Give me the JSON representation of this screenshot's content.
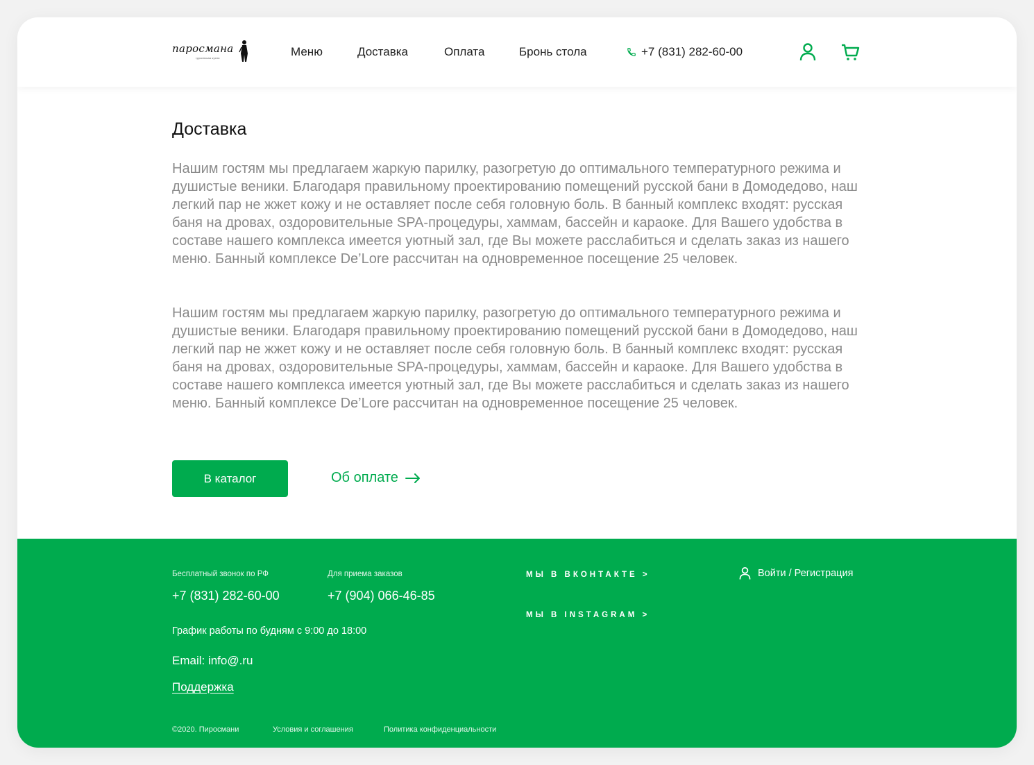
{
  "header": {
    "logo": {
      "name": "паросмана",
      "sub": "грузинская кухня"
    },
    "nav": [
      "Меню",
      "Доставка",
      "Оплата",
      "Бронь стола"
    ],
    "phone": "+7 (831) 282-60-00"
  },
  "main": {
    "title": "Доставка",
    "paragraphs": [
      "Нашим гостям мы предлагаем жаркую парилку, разогретую до оптимального температурного режима и душистые веники. Благодаря правильному проектированию помещений русской бани в Домодедово, наш легкий пар не жжет кожу и не оставляет после себя головную боль. В банный комплекс входят: русская баня на дровах,  оздоровительные SPA-процедуры, хаммам, бассейн и караоке. Для Вашего удобства в составе нашего комплекса имеется  уютный зал, где Вы можете расслабиться и сделать  заказ из нашего меню. Банный комплексе De’Lore  рассчитан на одновременное посещение 25 человек.",
      "Нашим гостям мы предлагаем жаркую парилку, разогретую до оптимального температурного режима и душистые веники. Благодаря правильному проектированию помещений русской бани в Домодедово, наш легкий пар не жжет кожу и не оставляет после себя головную боль. В банный комплекс входят: русская баня на дровах,  оздоровительные SPA-процедуры, хаммам, бассейн и караоке. Для Вашего удобства в составе нашего комплекса имеется  уютный зал, где Вы можете расслабиться и сделать  заказ из нашего меню. Банный комплексе De’Lore  рассчитан на одновременное посещение 25 человек."
    ],
    "catalog_button": "В каталог",
    "payment_link": "Об оплате"
  },
  "footer": {
    "free_call_label": "Бесплатный звонок по РФ",
    "free_call_phone": "+7 (831) 282-60-00",
    "orders_label": "Для приема заказов",
    "orders_phone": "+7 (904) 066-46-85",
    "schedule": "График работы по будням с 9:00 до 18:00",
    "email": "Email: info@.ru",
    "support": "Поддержка",
    "vk": "МЫ В ВКОНТАКТЕ >",
    "instagram": "МЫ В INSTAGRAM >",
    "login": "Войти / Регистрация",
    "copyright": "©2020. Пиросмани",
    "terms": "Условия и соглашения",
    "privacy": "Политика конфиденциальности"
  },
  "colors": {
    "accent": "#00ab4e",
    "text": "#1f1f1f",
    "muted": "#8a8a8a"
  },
  "icons": [
    "phone-icon",
    "user-icon",
    "cart-icon",
    "arrow-right-icon"
  ]
}
